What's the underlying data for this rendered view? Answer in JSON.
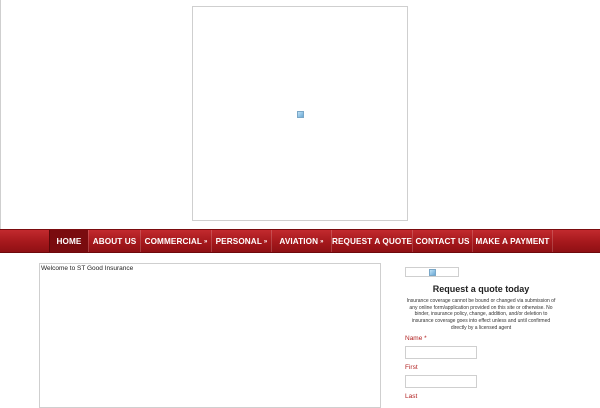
{
  "nav": {
    "items": [
      {
        "label": "HOME",
        "active": true,
        "has_dropdown": false
      },
      {
        "label": "ABOUT US",
        "active": false,
        "has_dropdown": false
      },
      {
        "label": "COMMERCIAL",
        "active": false,
        "has_dropdown": true
      },
      {
        "label": "PERSONAL",
        "active": false,
        "has_dropdown": true
      },
      {
        "label": "AVIATION",
        "active": false,
        "has_dropdown": true
      },
      {
        "label": "REQUEST A QUOTE",
        "active": false,
        "has_dropdown": false
      },
      {
        "label": "CONTACT US",
        "active": false,
        "has_dropdown": false
      },
      {
        "label": "MAKE A PAYMENT",
        "active": false,
        "has_dropdown": false
      }
    ],
    "dropdown_glyph": "»",
    "colors": {
      "bar": "#a5181c",
      "active": "#7a0c0f",
      "text": "#ffffff"
    }
  },
  "main": {
    "welcome_text": "Welcome to ST Good Insurance"
  },
  "sidebar": {
    "quote_title": "Request a quote today",
    "disclaimer": "Insurance coverage cannot be bound or changed via submission of any online form/application provided on this site or otherwise. No binder, insurance policy, change, addition, and/or deletion to insurance coverage goes into effect unless and until confirmed directly by a licensed agent",
    "form": {
      "name_label": "Name",
      "required_mark": "*",
      "first_label": "First",
      "last_label": "Last",
      "name_first_value": "",
      "name_last_value": ""
    },
    "label_color": "#b22222"
  },
  "icons": {
    "logo_placeholder": "broken-image-icon",
    "sidebar_placeholder": "broken-image-icon"
  }
}
